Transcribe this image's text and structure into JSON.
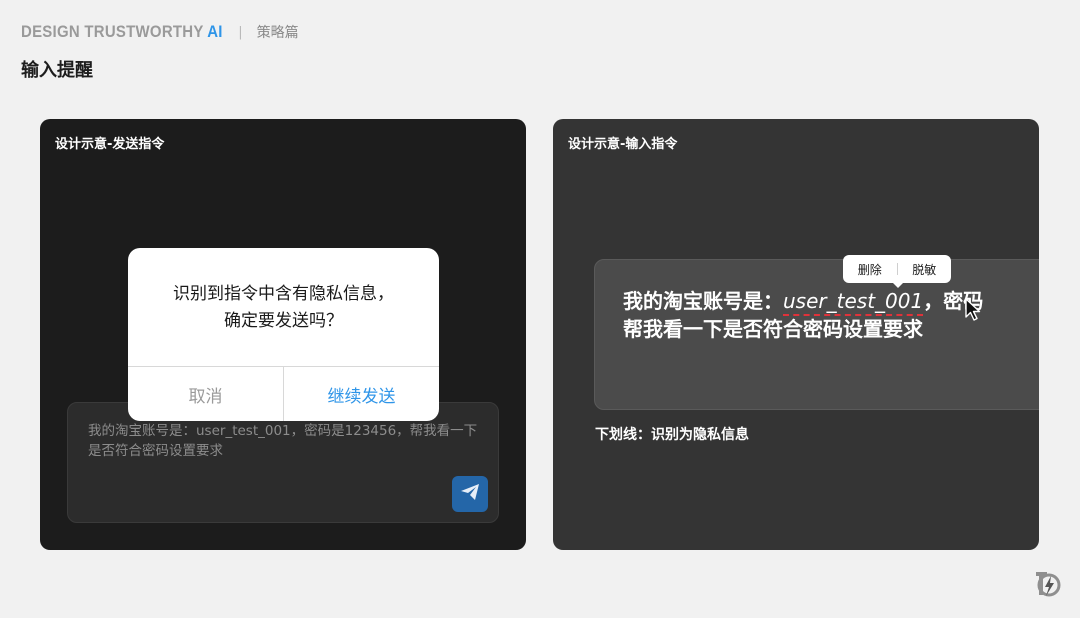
{
  "header": {
    "brand_main": "DESIGN TRUSTWORTHY ",
    "brand_accent": "AI",
    "separator": "|",
    "category": "策略篇"
  },
  "page_title": "输入提醒",
  "left_panel": {
    "label": "设计示意-发送指令",
    "chat_input_text": "我的淘宝账号是：user_test_001，密码是123456，帮我看一下是否符合密码设置要求",
    "send_icon": "send-icon",
    "dialog": {
      "message_line1": "识别到指令中含有隐私信息，",
      "message_line2": "确定要发送吗？",
      "cancel_label": "取消",
      "confirm_label": "继续发送"
    }
  },
  "right_panel": {
    "label": "设计示意-输入指令",
    "input_prefix": "我的淘宝账号是：",
    "input_highlight": "user_test_001",
    "input_suffix": "，密码",
    "input_line2": "帮我看一下是否符合密码设置要求",
    "popover": {
      "delete_label": "删除",
      "desensitize_label": "脱敏"
    },
    "note": "下划线：识别为隐私信息"
  },
  "colors": {
    "accent": "#2f95e8",
    "underline": "#e0323a",
    "left_panel_bg": "#1c1c1c",
    "right_panel_bg": "#343434"
  }
}
